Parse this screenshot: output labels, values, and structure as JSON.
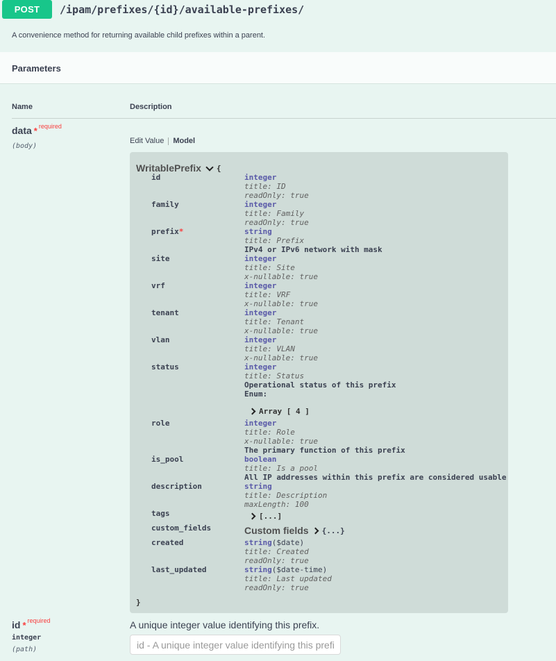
{
  "operation": {
    "method": "POST",
    "path": "/ipam/prefixes/{id}/available-prefixes/",
    "description": "A convenience method for returning available child prefixes within a parent."
  },
  "parameters": {
    "section_title": "Parameters",
    "col_name": "Name",
    "col_description": "Description",
    "required_label": "required",
    "star": "*",
    "data_param": {
      "name": "data",
      "in": "(body)",
      "tab_edit": "Edit Value",
      "tab_model": "Model"
    },
    "id_param": {
      "name": "id",
      "type": "integer",
      "in": "(path)",
      "description": "A unique integer value identifying this prefix.",
      "placeholder": "id - A unique integer value identifying this prefix."
    }
  },
  "model": {
    "name": "WritablePrefix",
    "open_brace": "{",
    "close_brace": "}",
    "properties": [
      {
        "name": "id",
        "lines": [
          {
            "k": "type",
            "v": "integer"
          },
          {
            "k": "meta",
            "v": "title: ID"
          },
          {
            "k": "meta",
            "v": "readOnly: true"
          }
        ]
      },
      {
        "name": "family",
        "lines": [
          {
            "k": "type",
            "v": "integer"
          },
          {
            "k": "meta",
            "v": "title: Family"
          },
          {
            "k": "meta",
            "v": "readOnly: true"
          }
        ]
      },
      {
        "name": "prefix",
        "required": true,
        "lines": [
          {
            "k": "type",
            "v": "string"
          },
          {
            "k": "meta",
            "v": "title: Prefix"
          },
          {
            "k": "desc",
            "v": "IPv4 or IPv6 network with mask"
          }
        ]
      },
      {
        "name": "site",
        "lines": [
          {
            "k": "type",
            "v": "integer"
          },
          {
            "k": "meta",
            "v": "title: Site"
          },
          {
            "k": "meta",
            "v": "x-nullable: true"
          }
        ]
      },
      {
        "name": "vrf",
        "lines": [
          {
            "k": "type",
            "v": "integer"
          },
          {
            "k": "meta",
            "v": "title: VRF"
          },
          {
            "k": "meta",
            "v": "x-nullable: true"
          }
        ]
      },
      {
        "name": "tenant",
        "lines": [
          {
            "k": "type",
            "v": "integer"
          },
          {
            "k": "meta",
            "v": "title: Tenant"
          },
          {
            "k": "meta",
            "v": "x-nullable: true"
          }
        ]
      },
      {
        "name": "vlan",
        "lines": [
          {
            "k": "type",
            "v": "integer"
          },
          {
            "k": "meta",
            "v": "title: VLAN"
          },
          {
            "k": "meta",
            "v": "x-nullable: true"
          }
        ]
      },
      {
        "name": "status",
        "lines": [
          {
            "k": "type",
            "v": "integer"
          },
          {
            "k": "meta",
            "v": "title: Status"
          },
          {
            "k": "desc",
            "v": "Operational status of this prefix"
          },
          {
            "k": "desc",
            "v": "Enum:"
          },
          {
            "k": "gap"
          },
          {
            "k": "arr",
            "v": "Array [ 4 ]"
          }
        ]
      },
      {
        "name": "role",
        "lines": [
          {
            "k": "type",
            "v": "integer"
          },
          {
            "k": "meta",
            "v": "title: Role"
          },
          {
            "k": "meta",
            "v": "x-nullable: true"
          },
          {
            "k": "desc",
            "v": "The primary function of this prefix"
          }
        ]
      },
      {
        "name": "is_pool",
        "lines": [
          {
            "k": "type",
            "v": "boolean"
          },
          {
            "k": "meta",
            "v": "title: Is a pool"
          },
          {
            "k": "desc",
            "v": "All IP addresses within this prefix are considered usable"
          }
        ]
      },
      {
        "name": "description",
        "lines": [
          {
            "k": "type",
            "v": "string"
          },
          {
            "k": "meta",
            "v": "title: Description"
          },
          {
            "k": "meta",
            "v": "maxLength: 100"
          }
        ]
      },
      {
        "name": "tags",
        "lines": [
          {
            "k": "arr",
            "v": "[...]"
          }
        ]
      },
      {
        "name": "custom_fields",
        "lines": [
          {
            "k": "cf",
            "title": "Custom fields",
            "v": "{...}"
          }
        ]
      },
      {
        "name": "created",
        "lines": [
          {
            "k": "type",
            "v": "string",
            "fmt": "($date)"
          },
          {
            "k": "meta",
            "v": "title: Created"
          },
          {
            "k": "meta",
            "v": "readOnly: true"
          }
        ]
      },
      {
        "name": "last_updated",
        "lines": [
          {
            "k": "type",
            "v": "string",
            "fmt": "($date-time)"
          },
          {
            "k": "meta",
            "v": "title: Last updated"
          },
          {
            "k": "meta",
            "v": "readOnly: true"
          }
        ]
      }
    ]
  }
}
